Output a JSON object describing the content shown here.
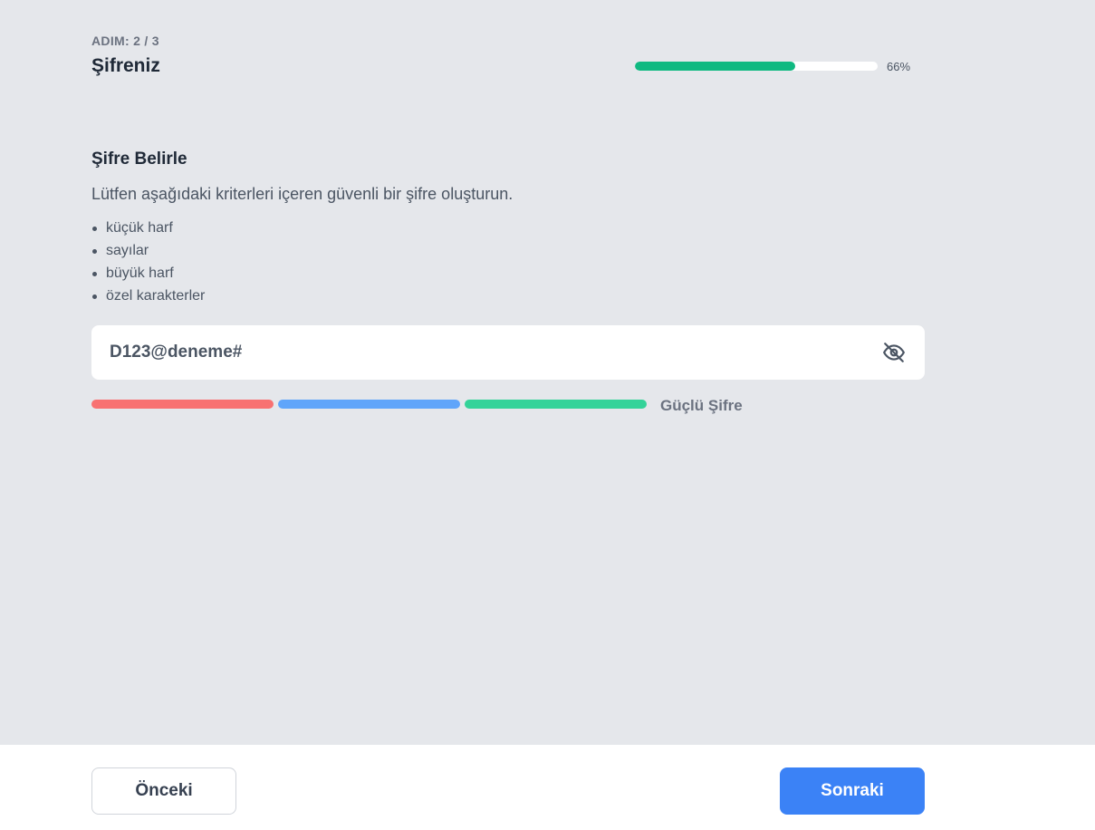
{
  "header": {
    "step_label": "ADIM: 2 / 3",
    "title": "Şifreniz",
    "progress_percent": 66,
    "progress_text": "66%",
    "progress_color": "#10b981"
  },
  "section": {
    "title": "Şifre Belirle",
    "description": "Lütfen aşağıdaki kriterleri içeren güvenli bir şifre oluşturun.",
    "criteria": [
      "küçük harf",
      "sayılar",
      "büyük harf",
      "özel karakterler"
    ]
  },
  "password_field": {
    "value": "D123@deneme#",
    "toggle_icon": "eye-off-icon"
  },
  "strength": {
    "segment_colors": [
      "#f87171",
      "#60a5fa",
      "#34d399"
    ],
    "label": "Güçlü Şifre"
  },
  "footer": {
    "prev_label": "Önceki",
    "next_label": "Sonraki",
    "next_color": "#3b82f6"
  }
}
